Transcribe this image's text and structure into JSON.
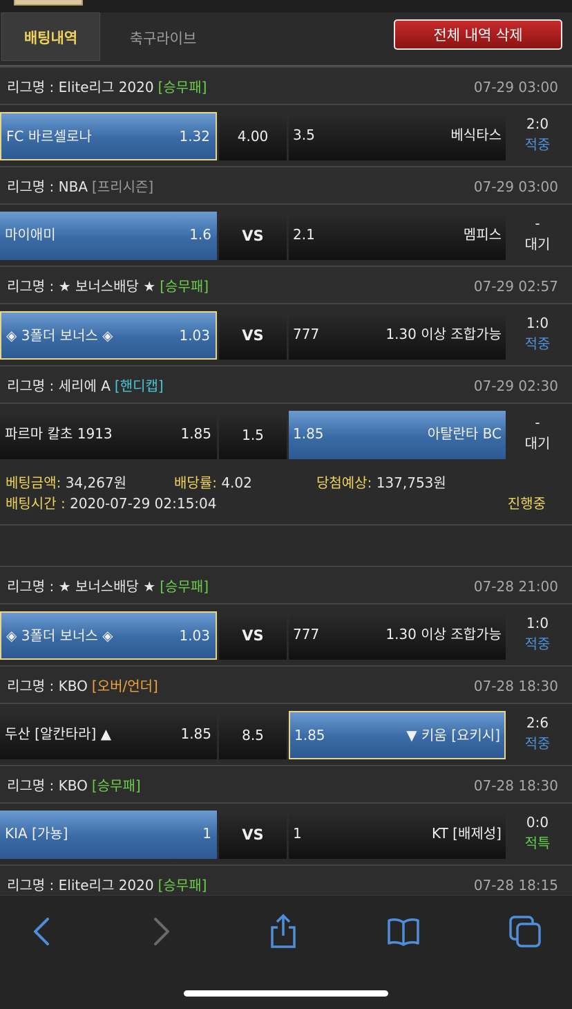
{
  "tabs": {
    "active": "배팅내역",
    "inactive": "축구라이브"
  },
  "delete_all_label": "전체 내역 삭제",
  "league_prefix": "리그명 : ",
  "colors": {
    "green": "#6bcf4a",
    "cyan": "#4cc6d9",
    "orange": "#f0a43c",
    "gray": "#9a9a9a",
    "status_blue": "#4f8ed8",
    "status_green": "#5ed04a",
    "status_yellow": "#f0d35c"
  },
  "games": [
    {
      "league": "Elite리그 2020",
      "tag": "[승무패]",
      "tag_color": "green",
      "time": "07-29 03:00",
      "home": {
        "name": "FC 바르셀로나",
        "odds": "1.32",
        "selected": true,
        "bordered": true
      },
      "mid": "4.00",
      "mid_vs": false,
      "away": {
        "name": "베식타스",
        "odds": "3.5",
        "selected": false,
        "bordered": false
      },
      "score": "2:0",
      "status": "적중",
      "status_color": "status_blue"
    },
    {
      "league": "NBA",
      "tag": "[프리시즌]",
      "tag_color": "gray",
      "time": "07-29 03:00",
      "home": {
        "name": "마이애미",
        "odds": "1.6",
        "selected": true,
        "bordered": false
      },
      "mid": "VS",
      "mid_vs": true,
      "away": {
        "name": "멤피스",
        "odds": "2.1",
        "selected": false,
        "bordered": false
      },
      "score": "-",
      "status": "대기",
      "status_color": "plain"
    },
    {
      "league": "★ 보너스배당 ★",
      "tag": "[승무패]",
      "tag_color": "green",
      "time": "07-29 02:57",
      "home": {
        "name": "◈ 3폴더 보너스 ◈",
        "odds": "1.03",
        "selected": true,
        "bordered": true
      },
      "mid": "VS",
      "mid_vs": true,
      "away": {
        "name": "1.30 이상 조합가능",
        "odds": "777",
        "selected": false,
        "bordered": false
      },
      "score": "1:0",
      "status": "적중",
      "status_color": "status_blue"
    },
    {
      "league": "세리에 A",
      "tag": "[핸디캡]",
      "tag_color": "cyan",
      "time": "07-29 02:30",
      "home": {
        "name": "파르마 칼초 1913",
        "odds": "1.85",
        "selected": false,
        "bordered": false
      },
      "mid": "1.5",
      "mid_vs": false,
      "away": {
        "name": "아탈란타 BC",
        "odds": "1.85",
        "selected": true,
        "bordered": false
      },
      "score": "-",
      "status": "대기",
      "status_color": "plain"
    },
    {
      "league": "★ 보너스배당 ★",
      "tag": "[승무패]",
      "tag_color": "green",
      "time": "07-28 21:00",
      "home": {
        "name": "◈ 3폴더 보너스 ◈",
        "odds": "1.03",
        "selected": true,
        "bordered": true
      },
      "mid": "VS",
      "mid_vs": true,
      "away": {
        "name": "1.30 이상 조합가능",
        "odds": "777",
        "selected": false,
        "bordered": false
      },
      "score": "1:0",
      "status": "적중",
      "status_color": "status_blue"
    },
    {
      "league": "KBO",
      "tag": "[오버/언더]",
      "tag_color": "orange",
      "time": "07-28 18:30",
      "home": {
        "name": "두산 [알칸타라] ▲",
        "odds": "1.85",
        "selected": false,
        "bordered": false
      },
      "mid": "8.5",
      "mid_vs": false,
      "away": {
        "name": "▼ 키움 [요키시]",
        "odds": "1.85",
        "selected": true,
        "bordered": true
      },
      "score": "2:6",
      "status": "적중",
      "status_color": "status_blue"
    },
    {
      "league": "KBO",
      "tag": "[승무패]",
      "tag_color": "green",
      "time": "07-28 18:30",
      "home": {
        "name": "KIA [가뇽]",
        "odds": "1",
        "selected": true,
        "bordered": false
      },
      "mid": "VS",
      "mid_vs": true,
      "away": {
        "name": "KT [배제성]",
        "odds": "1",
        "selected": false,
        "bordered": false
      },
      "score": "0:0",
      "status": "적특",
      "status_color": "status_green"
    },
    {
      "league": "Elite리그 2020",
      "tag": "[승무패]",
      "tag_color": "green",
      "time": "07-28 18:15"
    }
  ],
  "summary": {
    "bet_amount_label": "베팅금액:",
    "bet_amount": "34,267원",
    "odds_label": "배당률:",
    "odds": "4.02",
    "expected_label": "당첨예상:",
    "expected": "137,753원",
    "time_label": "배팅시간 :",
    "time": "2020-07-29 02:15:04",
    "status": "진행중"
  },
  "toolbar": {
    "icons": [
      "back-icon",
      "forward-icon",
      "share-icon",
      "bookmarks-icon",
      "tabs-icon"
    ]
  }
}
